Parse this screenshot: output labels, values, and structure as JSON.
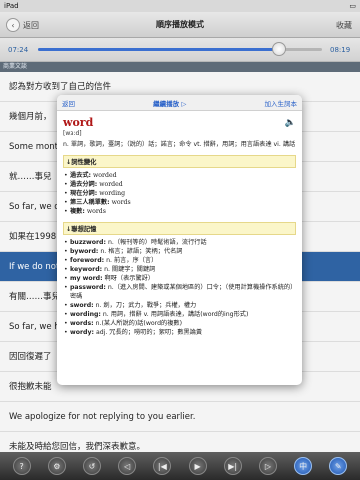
{
  "status": {
    "left": "iPad",
    "time": "",
    "right": ""
  },
  "nav": {
    "back": "返回",
    "title": "順序播放模式",
    "fav": "收藏"
  },
  "progress": {
    "elapsed": "07:24",
    "remaining": "08:19",
    "fraction": 0.85
  },
  "section_label": "商業文談",
  "lines": [
    "認為對方收到了自己的信件",
    "幾個月前，",
    "Some mont",
    "就……事兒",
    "So far, we d",
    "如果在1998",
    "If we do not",
    "有關……事兒",
    "So far, we h",
    "因回復遲了",
    "很抱歉未能",
    "We apologize for not replying to you earlier.",
    "未能及時給您回信，我們深表歉意。"
  ],
  "highlight_index": 6,
  "popover": {
    "back": "返回",
    "continue": "繼續播放 ▷",
    "add": "加入生詞本",
    "word": "word",
    "phonetic": "[wɜ:d]",
    "definition": "n. 單詞，歌詞，臺詞；（說的）話；諾言；命令 vt. 措辭，用詞；用言語表達 vi. 講話",
    "forms_title": "↓詞性變化",
    "forms": [
      {
        "k": "過去式:",
        "v": "worded"
      },
      {
        "k": "過去分詞:",
        "v": "worded"
      },
      {
        "k": "現在分詞:",
        "v": "wording"
      },
      {
        "k": "第三人稱單數:",
        "v": "words"
      },
      {
        "k": "複數:",
        "v": "words"
      }
    ],
    "assoc_title": "↓聯想記憶",
    "assoc": [
      {
        "k": "buzzword:",
        "v": "n.（報刊等的）時髦術語，流行行話"
      },
      {
        "k": "byword:",
        "v": "n. 格言；諺語；笑柄；代名詞"
      },
      {
        "k": "foreword:",
        "v": "n. 前言，序（言）"
      },
      {
        "k": "keyword:",
        "v": "n. 關鍵字；關鍵詞"
      },
      {
        "k": "my word:",
        "v": "啊呀（表示驚訝）"
      },
      {
        "k": "password:",
        "v": "n.（進入房間、建築或某個地區的）口令；（使用計算機操作系統的）密碼"
      },
      {
        "k": "sword:",
        "v": "n. 劍，刀；武力，戰爭；兵權，權力"
      },
      {
        "k": "wording:",
        "v": "n. 用詞，措辭 v. 用詞語表達，講話(word的ing形式)"
      },
      {
        "k": "words:",
        "v": "n.(某人所說的)話(word的複數)"
      },
      {
        "k": "wordy:",
        "v": "adj. 冗長的；嘮叨的；絮叨；數黑論黃"
      }
    ]
  },
  "toolbar": [
    "?",
    "⚙",
    "↺",
    "◁",
    "|◀",
    "▶",
    "▶|",
    "▷",
    "中",
    "✎"
  ]
}
